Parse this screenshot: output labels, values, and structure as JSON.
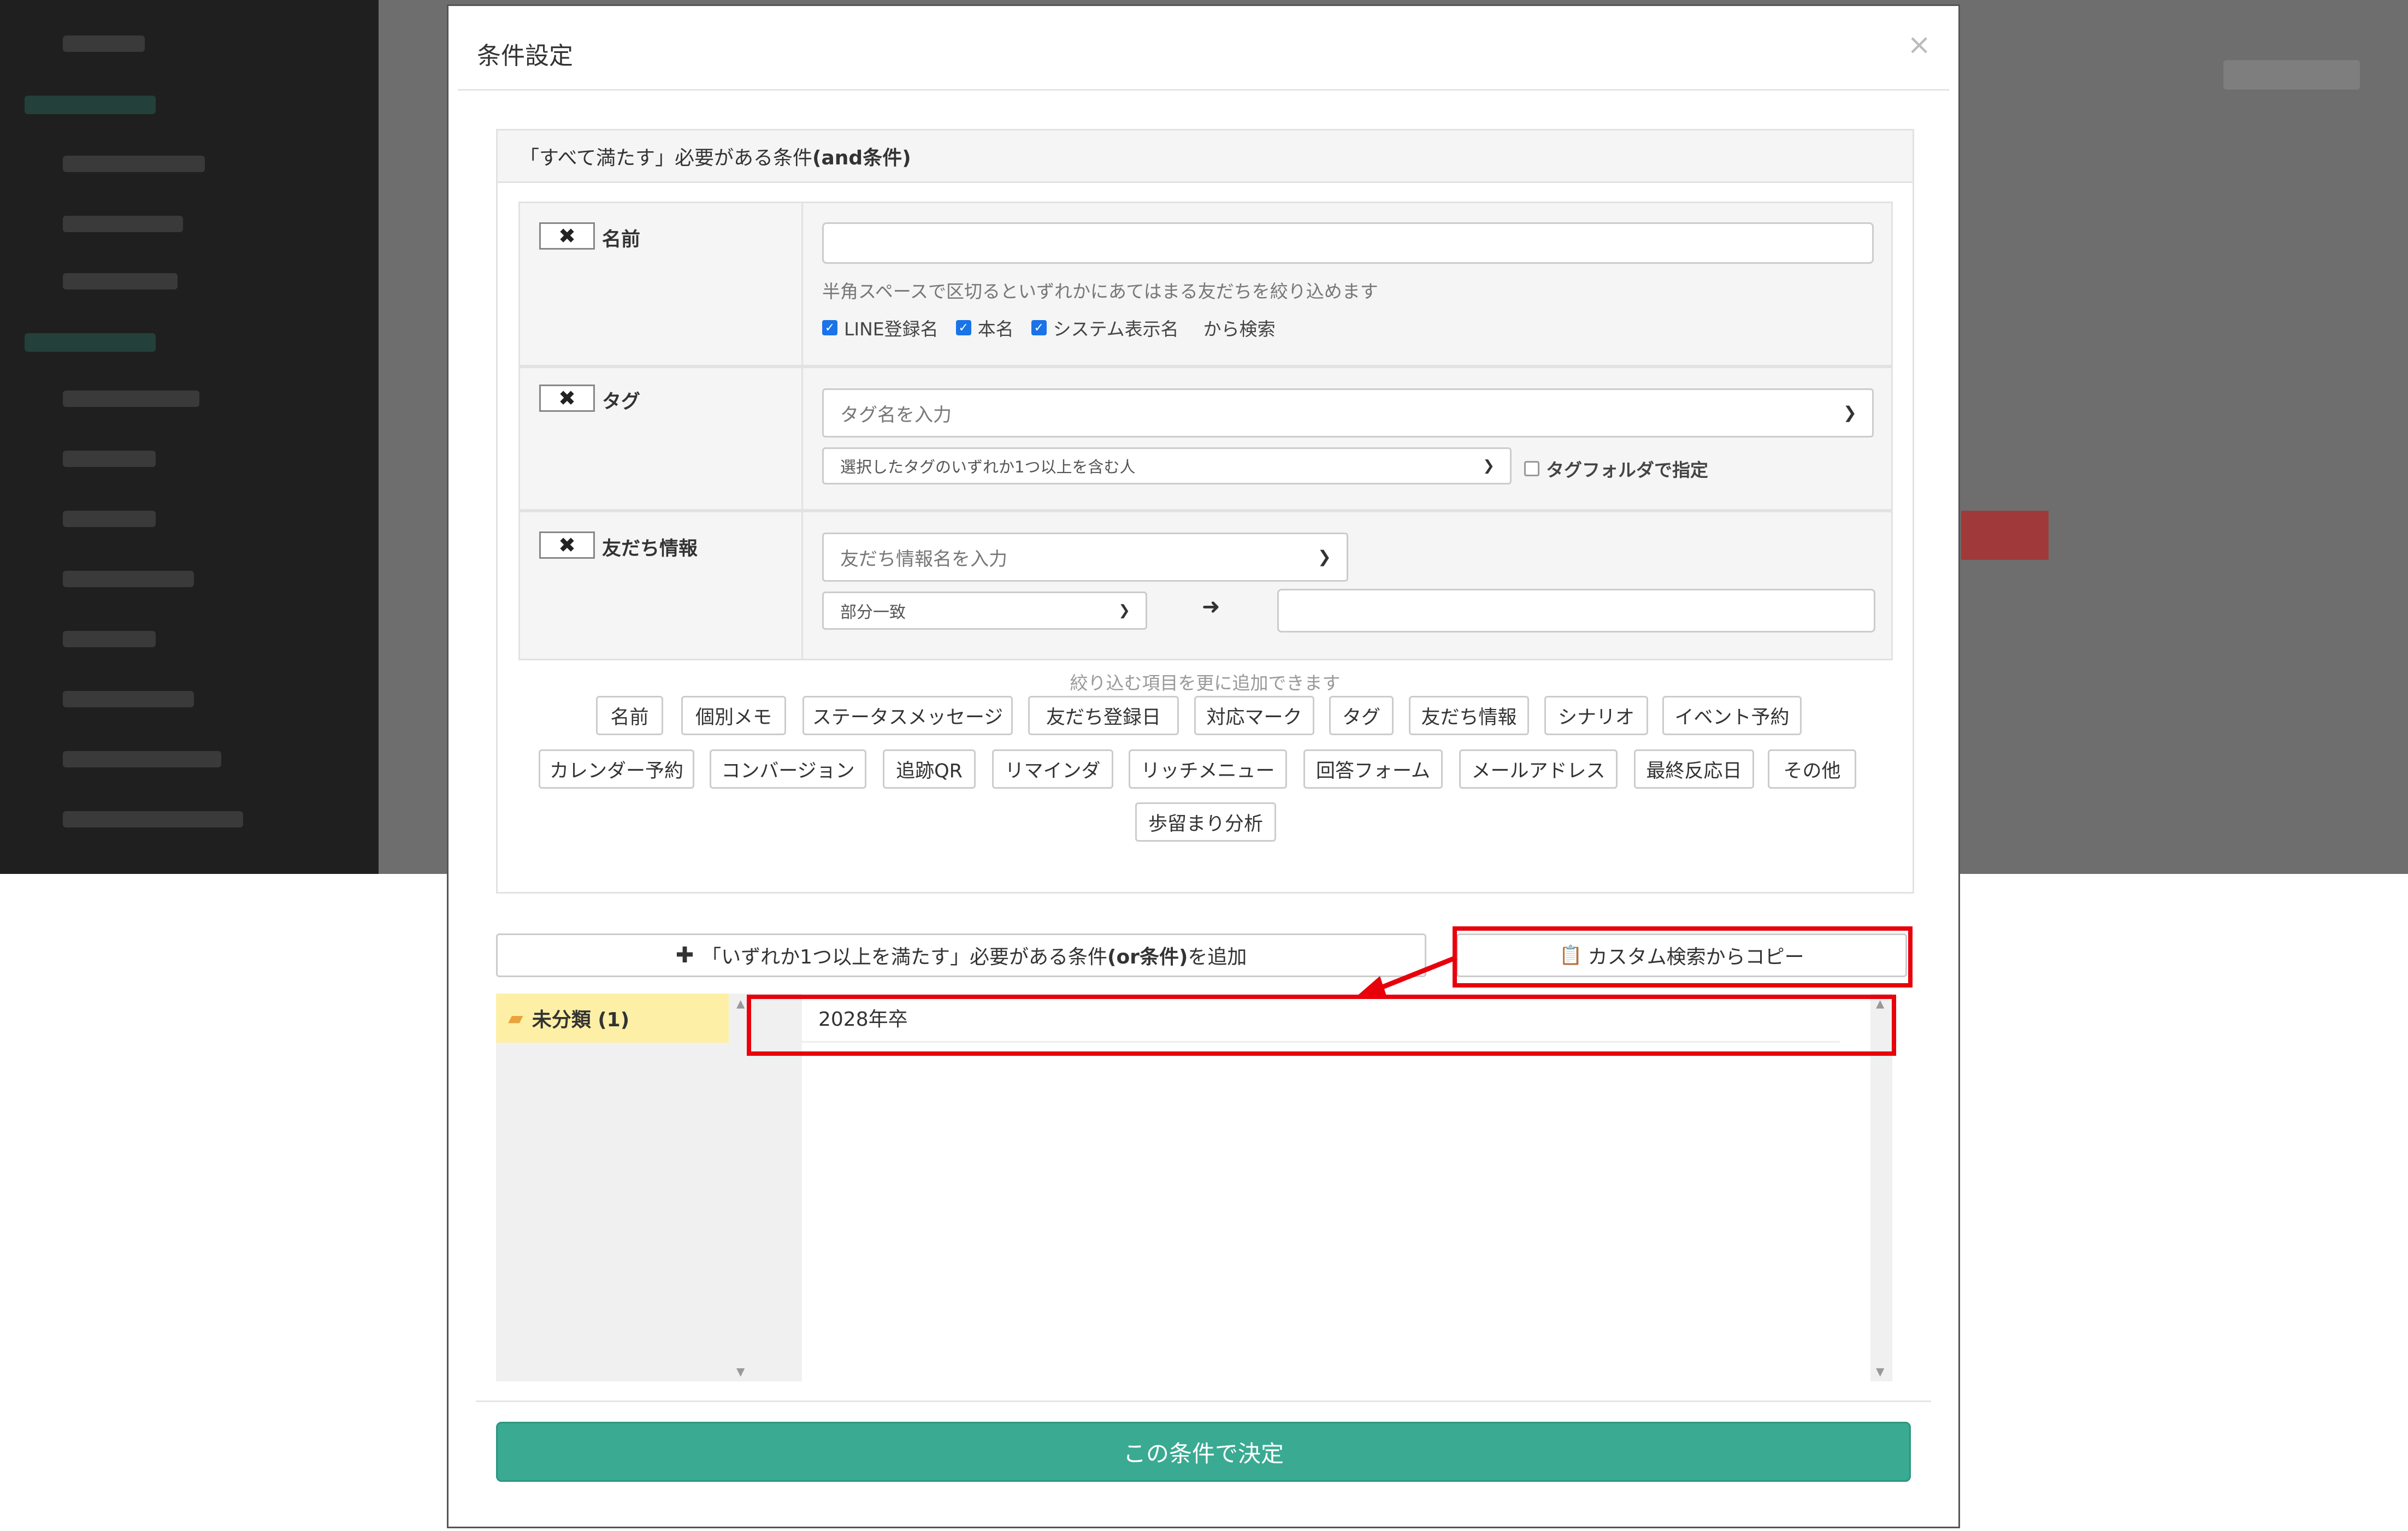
{
  "modal": {
    "title": "条件設定",
    "close_icon": "close-icon"
  },
  "and_panel": {
    "header_prefix": "「すべて満たす」必要がある条件 ",
    "header_bold": "(and条件)"
  },
  "conditions": {
    "name": {
      "remove_glyph": "✖",
      "label": "名前",
      "input_value": "",
      "help": "半角スペースで区切るといずれかにあてはまる友だちを絞り込めます",
      "checks": [
        {
          "label": "LINE登録名",
          "checked": true
        },
        {
          "label": "本名",
          "checked": true
        },
        {
          "label": "システム表示名",
          "checked": true
        }
      ],
      "suffix": "から検索"
    },
    "tag": {
      "remove_glyph": "✖",
      "label": "タグ",
      "search_placeholder": "タグ名を入力",
      "mode_selected": "選択したタグのいずれか1つ以上を含む人",
      "folder_check_label": "タグフォルダで指定",
      "folder_checked": false
    },
    "friend_info": {
      "remove_glyph": "✖",
      "label": "友だち情報",
      "search_placeholder": "友だち情報名を入力",
      "match_selected": "部分一致",
      "arrow_glyph": "➜",
      "value": ""
    }
  },
  "add_hint": "絞り込む項目を更に追加できます",
  "chips": [
    "名前",
    "個別メモ",
    "ステータスメッセージ",
    "友だち登録日",
    "対応マーク",
    "タグ",
    "友だち情報",
    "シナリオ",
    "イベント予約",
    "カレンダー予約",
    "コンバージョン",
    "追跡QR",
    "リマインダ",
    "リッチメニュー",
    "回答フォーム",
    "メールアドレス",
    "最終反応日",
    "その他",
    "歩留まり分析"
  ],
  "or_button": {
    "icon": "plus-icon",
    "prefix": "「いずれか1つ以上を満たす」必要がある条件",
    "bold": "(or条件)",
    "suffix": "を追加"
  },
  "copy_button": {
    "icon": "copy-icon",
    "label": "カスタム検索からコピー"
  },
  "folders": [
    {
      "label": "未分類 (1)",
      "icon": "folder-open-icon"
    }
  ],
  "saved_searches": [
    "2028年卒"
  ],
  "submit_label": "この条件で決定",
  "colors": {
    "accent_green": "#3aaa92",
    "annotation_red": "#e8000b",
    "folder_highlight": "#fdf0a6"
  }
}
